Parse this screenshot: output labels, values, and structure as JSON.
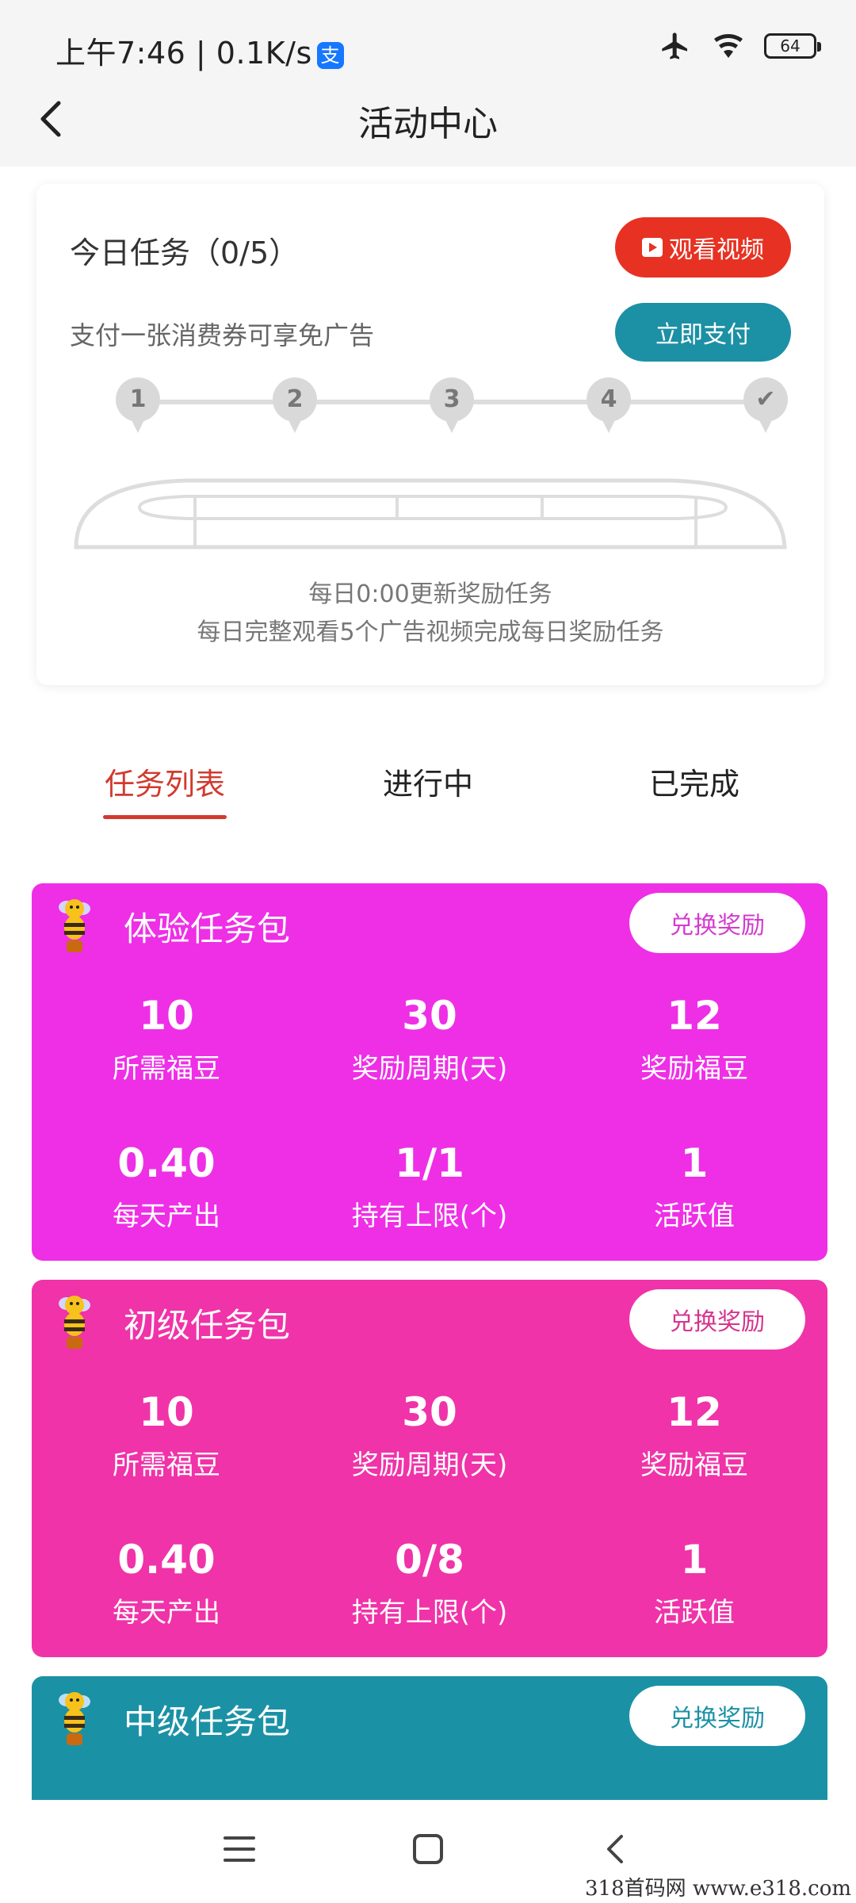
{
  "status_bar": {
    "time": "上午7:46 | 0.1K/s",
    "alipay_glyph": "支",
    "battery": "64"
  },
  "header": {
    "title": "活动中心"
  },
  "task_card": {
    "title": "今日任务（0/5）",
    "video_button": "观看视频",
    "ad_free_text": "支付一张消费券可享免广告",
    "pay_button": "立即支付",
    "steps": [
      "1",
      "2",
      "3",
      "4",
      "✔"
    ],
    "update_text": "每日0:00更新奖励任务",
    "desc_text": "每日完整观看5个广告视频完成每日奖励任务"
  },
  "tabs": {
    "list": "任务列表",
    "in_progress": "进行中",
    "completed": "已完成"
  },
  "packages": [
    {
      "title": "体验任务包",
      "button": "兑换奖励",
      "color": "#ee2fe6",
      "btn_text_color": "#d43bcf",
      "row1": [
        {
          "value": "10",
          "label": "所需福豆"
        },
        {
          "value": "30",
          "label": "奖励周期(天)"
        },
        {
          "value": "12",
          "label": "奖励福豆"
        }
      ],
      "row2": [
        {
          "value": "0.40",
          "label": "每天产出"
        },
        {
          "value": "1/1",
          "label": "持有上限(个)"
        },
        {
          "value": "1",
          "label": "活跃值"
        }
      ]
    },
    {
      "title": "初级任务包",
      "button": "兑换奖励",
      "color": "#f033a8",
      "btn_text_color": "#d6348f",
      "row1": [
        {
          "value": "10",
          "label": "所需福豆"
        },
        {
          "value": "30",
          "label": "奖励周期(天)"
        },
        {
          "value": "12",
          "label": "奖励福豆"
        }
      ],
      "row2": [
        {
          "value": "0.40",
          "label": "每天产出"
        },
        {
          "value": "0/8",
          "label": "持有上限(个)"
        },
        {
          "value": "1",
          "label": "活跃值"
        }
      ]
    },
    {
      "title": "中级任务包",
      "button": "兑换奖励",
      "color": "#1b91a5",
      "btn_text_color": "#1b91a5"
    }
  ],
  "watermark": "318首码网  www.e318.com"
}
